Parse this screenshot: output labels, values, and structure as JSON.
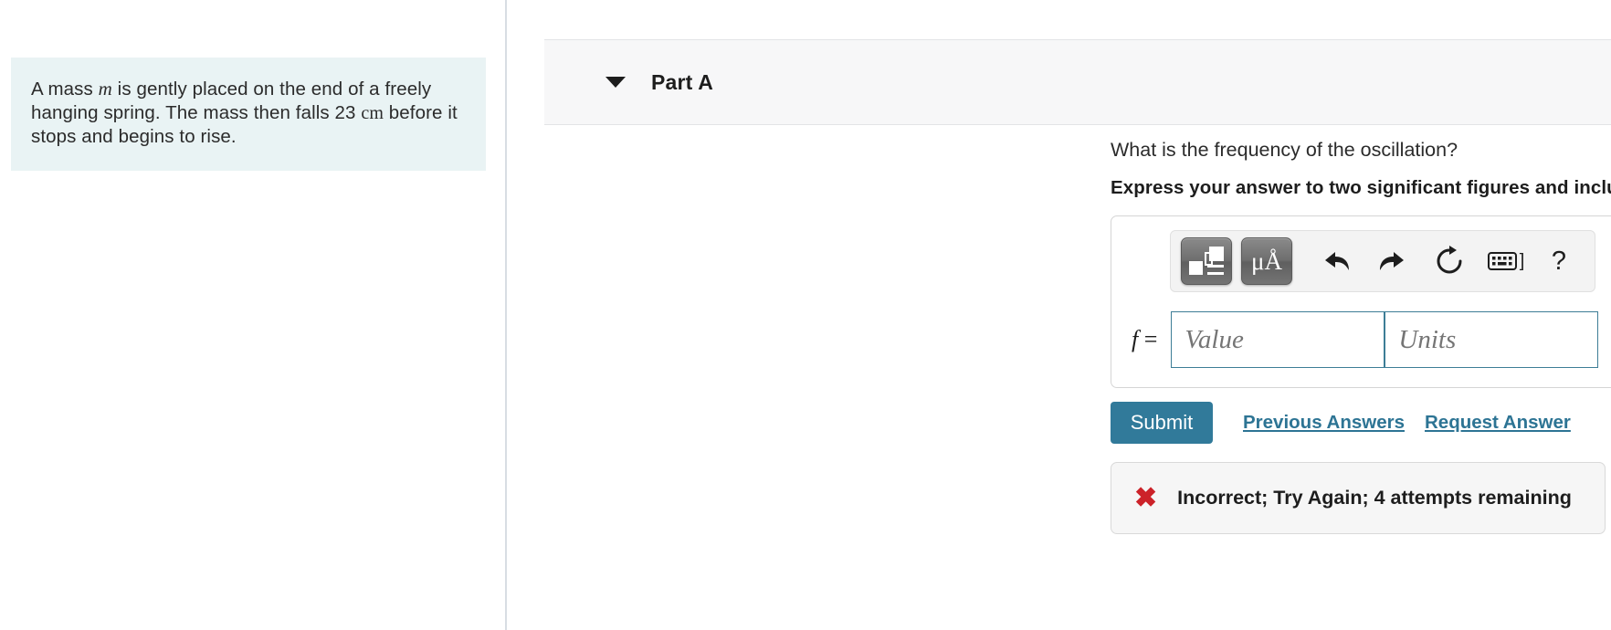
{
  "problem": {
    "text_part1": "A mass ",
    "variable": "m",
    "text_part2": " is gently placed on the end of a freely hanging spring. The mass then falls 23 ",
    "unit": "cm",
    "text_part3": " before it stops and begins to rise.",
    "background_color": "#e9f3f4"
  },
  "part": {
    "title": "Part A",
    "toggle_icon": "caret-down-icon",
    "question": "What is the frequency of the oscillation?",
    "instruction": "Express your answer to two significant figures and include the appropriate units."
  },
  "toolbar": {
    "template_button": "math-template-icon",
    "units_button": "μÅ",
    "undo_icon": "undo-arrow-icon",
    "redo_icon": "redo-arrow-icon",
    "reset_icon": "reset-circular-arrow-icon",
    "keyboard_icon": "keyboard-icon",
    "keyboard_bracket": "]",
    "help_icon": "?"
  },
  "answer": {
    "label": "f =",
    "label_variable": "f",
    "label_equals": "=",
    "value_placeholder": "Value",
    "units_placeholder": "Units",
    "value": "",
    "units": "",
    "border_color": "#3d7d96"
  },
  "actions": {
    "submit_label": "Submit",
    "submit_color": "#317a9a",
    "previous_answers_label": "Previous Answers",
    "request_answer_label": "Request Answer",
    "link_color": "#2d7494"
  },
  "feedback": {
    "icon": "cross-mark-icon",
    "icon_glyph": "✖",
    "icon_color": "#cc2229",
    "message": "Incorrect; Try Again; 4 attempts remaining"
  }
}
